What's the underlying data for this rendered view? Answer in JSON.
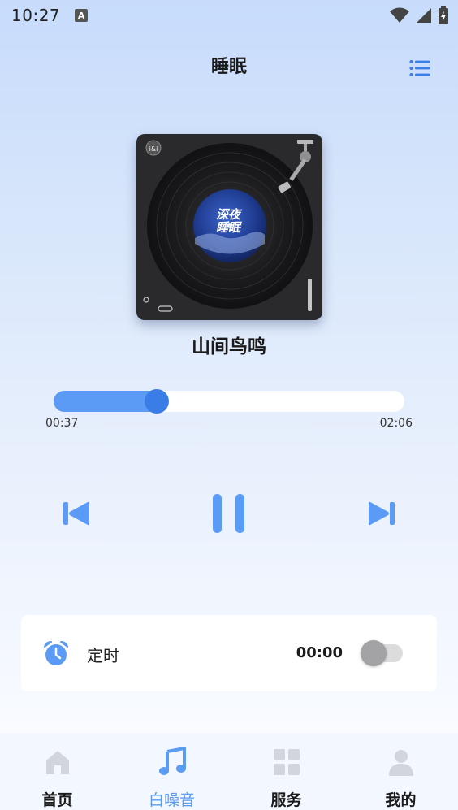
{
  "status_bar": {
    "time": "10:27",
    "a_badge": "A"
  },
  "header": {
    "title": "睡眠",
    "list_icon": "list-icon"
  },
  "album": {
    "cover_text_line1": "深夜",
    "cover_text_line2": "睡眠",
    "badge": "i&i"
  },
  "track": {
    "name": "山间鸟鸣"
  },
  "progress": {
    "current": "00:37",
    "total": "02:06",
    "fraction": 0.293
  },
  "controls": {
    "prev_icon": "skip-previous-icon",
    "pause_icon": "pause-icon",
    "next_icon": "skip-next-icon"
  },
  "timer": {
    "label": "定时",
    "value": "00:00",
    "enabled": false
  },
  "nav": {
    "items": [
      {
        "label": "首页",
        "icon": "home-icon",
        "active": false
      },
      {
        "label": "白噪音",
        "icon": "music-note-icon",
        "active": true
      },
      {
        "label": "服务",
        "icon": "grid-icon",
        "active": false
      },
      {
        "label": "我的",
        "icon": "person-icon",
        "active": false
      }
    ]
  },
  "colors": {
    "accent": "#5b9bf5",
    "accent_dark": "#3a7de6",
    "inactive_icon": "#d2d5db",
    "toggle_knob": "#a3a3a6"
  }
}
